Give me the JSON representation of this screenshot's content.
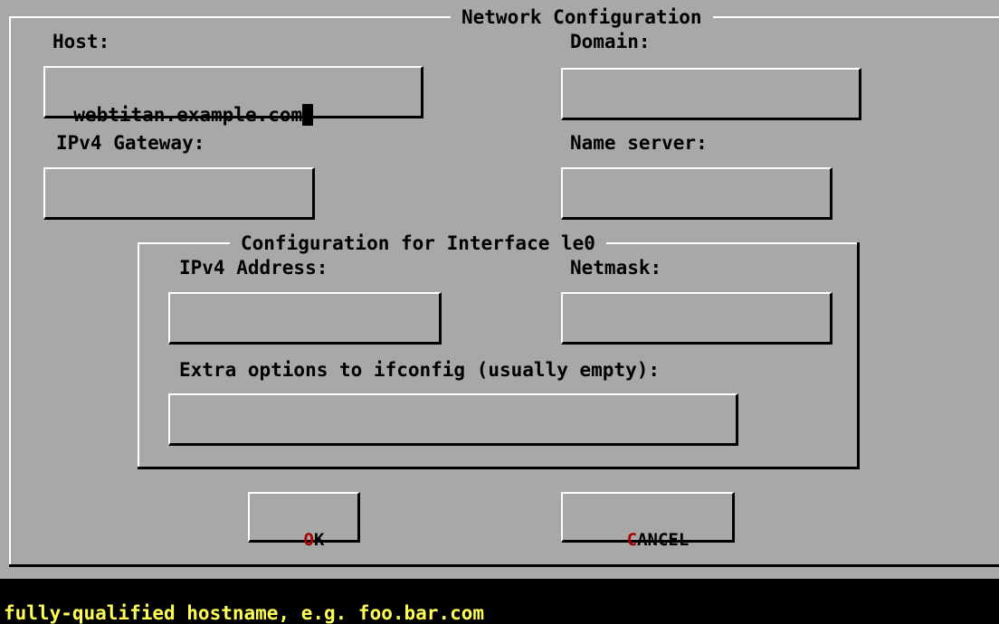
{
  "dialog": {
    "title": "Network Configuration",
    "host": {
      "label": "Host:",
      "value": "webtitan.example.com"
    },
    "domain": {
      "label": "Domain:",
      "value": ""
    },
    "gateway": {
      "label": "IPv4 Gateway:",
      "value": ""
    },
    "nameserver": {
      "label": "Name server:",
      "value": ""
    },
    "interface": {
      "title": "Configuration for Interface le0",
      "address": {
        "label": "IPv4 Address:",
        "value": ""
      },
      "netmask": {
        "label": "Netmask:",
        "value": ""
      },
      "extra": {
        "label": "Extra options to ifconfig (usually empty):",
        "value": ""
      }
    },
    "buttons": {
      "ok": {
        "hotkey": "O",
        "rest": "K"
      },
      "cancel": {
        "hotkey": "C",
        "rest": "ANCEL"
      }
    }
  },
  "status": {
    "hint": "fully-qualified hostname, e.g. foo.bar.com"
  },
  "colors": {
    "background": "#a8a8a8",
    "hotkey": "#a80000",
    "status_text": "#ffff55",
    "status_bg": "#000000"
  }
}
